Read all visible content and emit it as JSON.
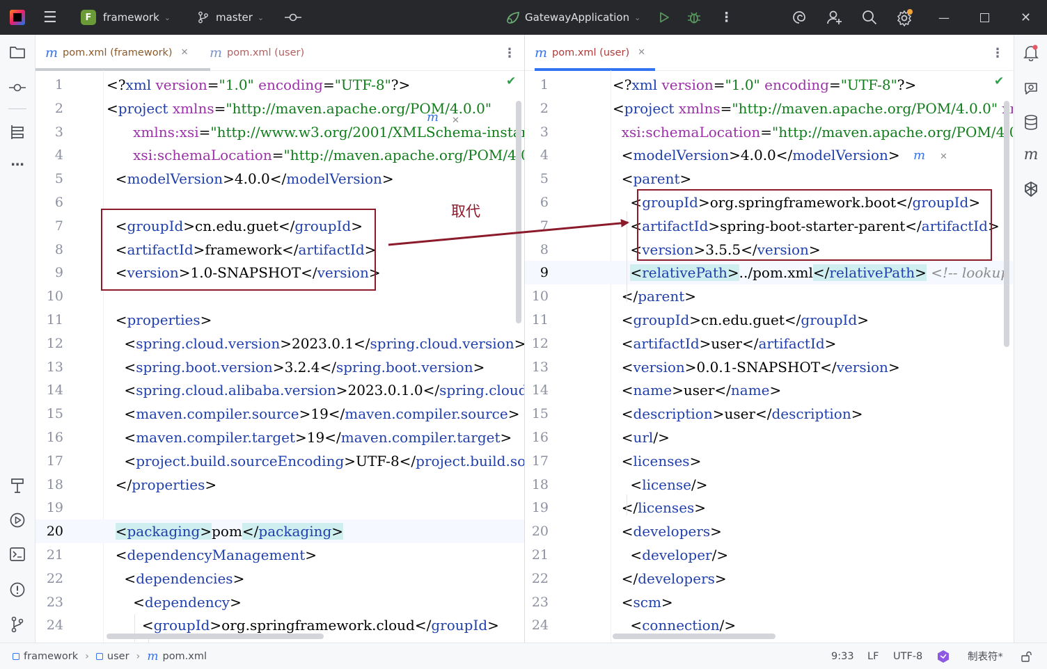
{
  "titlebar": {
    "project_initial": "F",
    "project_name": "framework",
    "branch": "master",
    "run_config": "GatewayApplication"
  },
  "left_pane": {
    "tabs": [
      {
        "label": "pom.xml (framework)",
        "active": true
      },
      {
        "label": "pom.xml (user)",
        "active": false
      }
    ],
    "current_line": 20,
    "lines": [
      [
        [
          "t",
          "<?"
        ],
        [
          "n",
          "xml "
        ],
        [
          "a",
          "version"
        ],
        [
          "t",
          "="
        ],
        [
          "v",
          "\"1.0\""
        ],
        [
          "t",
          " "
        ],
        [
          "a",
          "encoding"
        ],
        [
          "t",
          "="
        ],
        [
          "v",
          "\"UTF-8\""
        ],
        [
          "t",
          "?>"
        ]
      ],
      [
        [
          "t",
          "<"
        ],
        [
          "n",
          "project "
        ],
        [
          "a",
          "xmlns"
        ],
        [
          "t",
          "="
        ],
        [
          "v",
          "\"http://maven.apache.org/POM/4.0.0\""
        ]
      ],
      [
        [
          "t",
          "      "
        ],
        [
          "a",
          "xmlns:xsi"
        ],
        [
          "t",
          "="
        ],
        [
          "v",
          "\"http://www.w3.org/2001/XMLSchema-instance\""
        ]
      ],
      [
        [
          "t",
          "      "
        ],
        [
          "a",
          "xsi:schemaLocation"
        ],
        [
          "t",
          "="
        ],
        [
          "v",
          "\"http://maven.apache.org/POM/4.0.0 http://maven.apache.org/xsd/maven-4.0.0.xsd\""
        ],
        [
          "t",
          ">"
        ]
      ],
      [
        [
          "t",
          "  <"
        ],
        [
          "n",
          "modelVersion"
        ],
        [
          "t",
          ">4.0.0</"
        ],
        [
          "n",
          "modelVersion"
        ],
        [
          "t",
          ">"
        ]
      ],
      [],
      [
        [
          "t",
          "  <"
        ],
        [
          "n",
          "groupId"
        ],
        [
          "t",
          ">cn.edu.guet</"
        ],
        [
          "n",
          "groupId"
        ],
        [
          "t",
          ">"
        ]
      ],
      [
        [
          "t",
          "  <"
        ],
        [
          "n",
          "artifactId"
        ],
        [
          "t",
          ">framework</"
        ],
        [
          "n",
          "artifactId"
        ],
        [
          "t",
          ">"
        ]
      ],
      [
        [
          "t",
          "  <"
        ],
        [
          "n",
          "version"
        ],
        [
          "t",
          ">1.0-SNAPSHOT</"
        ],
        [
          "n",
          "version"
        ],
        [
          "t",
          ">"
        ]
      ],
      [],
      [
        [
          "t",
          "  <"
        ],
        [
          "n",
          "properties"
        ],
        [
          "t",
          ">"
        ]
      ],
      [
        [
          "t",
          "    <"
        ],
        [
          "n",
          "spring.cloud.version"
        ],
        [
          "t",
          ">2023.0.1</"
        ],
        [
          "n",
          "spring.cloud.version"
        ],
        [
          "t",
          ">"
        ]
      ],
      [
        [
          "t",
          "    <"
        ],
        [
          "n",
          "spring.boot.version"
        ],
        [
          "t",
          ">3.2.4</"
        ],
        [
          "n",
          "spring.boot.version"
        ],
        [
          "t",
          ">"
        ]
      ],
      [
        [
          "t",
          "    <"
        ],
        [
          "n",
          "spring.cloud.alibaba.version"
        ],
        [
          "t",
          ">2023.0.1.0</"
        ],
        [
          "n",
          "spring.cloud.alibaba.version"
        ],
        [
          "t",
          ">"
        ]
      ],
      [
        [
          "t",
          "    <"
        ],
        [
          "n",
          "maven.compiler.source"
        ],
        [
          "t",
          ">19</"
        ],
        [
          "n",
          "maven.compiler.source"
        ],
        [
          "t",
          ">"
        ]
      ],
      [
        [
          "t",
          "    <"
        ],
        [
          "n",
          "maven.compiler.target"
        ],
        [
          "t",
          ">19</"
        ],
        [
          "n",
          "maven.compiler.target"
        ],
        [
          "t",
          ">"
        ]
      ],
      [
        [
          "t",
          "    <"
        ],
        [
          "n",
          "project.build.sourceEncoding"
        ],
        [
          "t",
          ">UTF-8</"
        ],
        [
          "n",
          "project.build.sourceEncoding"
        ],
        [
          "t",
          ">"
        ]
      ],
      [
        [
          "t",
          "  </"
        ],
        [
          "n",
          "properties"
        ],
        [
          "t",
          ">"
        ]
      ],
      [],
      [
        [
          "t",
          "  "
        ],
        [
          "h",
          "<packaging>"
        ],
        [
          "t",
          "pom"
        ],
        [
          "h",
          "</packaging>"
        ]
      ],
      [
        [
          "t",
          "  <"
        ],
        [
          "n",
          "dependencyManagement"
        ],
        [
          "t",
          ">"
        ]
      ],
      [
        [
          "t",
          "    <"
        ],
        [
          "n",
          "dependencies"
        ],
        [
          "t",
          ">"
        ]
      ],
      [
        [
          "t",
          "      <"
        ],
        [
          "n",
          "dependency"
        ],
        [
          "t",
          ">"
        ]
      ],
      [
        [
          "t",
          "        <"
        ],
        [
          "n",
          "groupId"
        ],
        [
          "t",
          ">org.springframework.cloud</"
        ],
        [
          "n",
          "groupId"
        ],
        [
          "t",
          ">"
        ]
      ]
    ]
  },
  "right_pane": {
    "tabs": [
      {
        "label": "pom.xml (user)",
        "active": true
      }
    ],
    "current_line": 9,
    "lines": [
      [
        [
          "t",
          "<?"
        ],
        [
          "n",
          "xml "
        ],
        [
          "a",
          "version"
        ],
        [
          "t",
          "="
        ],
        [
          "v",
          "\"1.0\""
        ],
        [
          "t",
          " "
        ],
        [
          "a",
          "encoding"
        ],
        [
          "t",
          "="
        ],
        [
          "v",
          "\"UTF-8\""
        ],
        [
          "t",
          "?>"
        ]
      ],
      [
        [
          "t",
          "<"
        ],
        [
          "n",
          "project "
        ],
        [
          "a",
          "xmlns"
        ],
        [
          "t",
          "="
        ],
        [
          "v",
          "\"http://maven.apache.org/POM/4.0.0\""
        ],
        [
          "t",
          " "
        ],
        [
          "a",
          "xmlns:xsi"
        ],
        [
          "t",
          "="
        ],
        [
          "v",
          "\"http://www.w3.org/2001/XMLSchema-instance\""
        ]
      ],
      [
        [
          "t",
          "  "
        ],
        [
          "a",
          "xsi:schemaLocation"
        ],
        [
          "t",
          "="
        ],
        [
          "v",
          "\"http://maven.apache.org/POM/4.0.0 https://maven.apache.org/xsd/maven-4.0.0.xsd\""
        ],
        [
          "t",
          ">"
        ]
      ],
      [
        [
          "t",
          "  <"
        ],
        [
          "n",
          "modelVersion"
        ],
        [
          "t",
          ">4.0.0</"
        ],
        [
          "n",
          "modelVersion"
        ],
        [
          "t",
          ">"
        ]
      ],
      [
        [
          "t",
          "  <"
        ],
        [
          "n",
          "parent"
        ],
        [
          "t",
          ">"
        ]
      ],
      [
        [
          "t",
          "    <"
        ],
        [
          "n",
          "groupId"
        ],
        [
          "t",
          ">org.springframework.boot</"
        ],
        [
          "n",
          "groupId"
        ],
        [
          "t",
          ">"
        ]
      ],
      [
        [
          "t",
          "    <"
        ],
        [
          "n",
          "artifactId"
        ],
        [
          "t",
          ">spring-boot-starter-parent</"
        ],
        [
          "n",
          "artifactId"
        ],
        [
          "t",
          ">"
        ]
      ],
      [
        [
          "t",
          "    <"
        ],
        [
          "n",
          "version"
        ],
        [
          "t",
          ">3.5.5</"
        ],
        [
          "n",
          "version"
        ],
        [
          "t",
          ">"
        ]
      ],
      [
        [
          "t",
          "    "
        ],
        [
          "h",
          "<relativePath>"
        ],
        [
          "t",
          "../pom.xml"
        ],
        [
          "h",
          "</relativePath>"
        ],
        [
          "t",
          " "
        ],
        [
          "c",
          "<!-- lookup parent from repository -->"
        ]
      ],
      [
        [
          "t",
          "  </"
        ],
        [
          "n",
          "parent"
        ],
        [
          "t",
          ">"
        ]
      ],
      [
        [
          "t",
          "  <"
        ],
        [
          "n",
          "groupId"
        ],
        [
          "t",
          ">cn.edu.guet</"
        ],
        [
          "n",
          "groupId"
        ],
        [
          "t",
          ">"
        ]
      ],
      [
        [
          "t",
          "  <"
        ],
        [
          "n",
          "artifactId"
        ],
        [
          "t",
          ">user</"
        ],
        [
          "n",
          "artifactId"
        ],
        [
          "t",
          ">"
        ]
      ],
      [
        [
          "t",
          "  <"
        ],
        [
          "n",
          "version"
        ],
        [
          "t",
          ">0.0.1-SNAPSHOT</"
        ],
        [
          "n",
          "version"
        ],
        [
          "t",
          ">"
        ]
      ],
      [
        [
          "t",
          "  <"
        ],
        [
          "n",
          "name"
        ],
        [
          "t",
          ">user</"
        ],
        [
          "n",
          "name"
        ],
        [
          "t",
          ">"
        ]
      ],
      [
        [
          "t",
          "  <"
        ],
        [
          "n",
          "description"
        ],
        [
          "t",
          ">user</"
        ],
        [
          "n",
          "description"
        ],
        [
          "t",
          ">"
        ]
      ],
      [
        [
          "t",
          "  <"
        ],
        [
          "n",
          "url"
        ],
        [
          "t",
          "/>"
        ]
      ],
      [
        [
          "t",
          "  <"
        ],
        [
          "n",
          "licenses"
        ],
        [
          "t",
          ">"
        ]
      ],
      [
        [
          "t",
          "    <"
        ],
        [
          "n",
          "license"
        ],
        [
          "t",
          "/>"
        ]
      ],
      [
        [
          "t",
          "  </"
        ],
        [
          "n",
          "licenses"
        ],
        [
          "t",
          ">"
        ]
      ],
      [
        [
          "t",
          "  <"
        ],
        [
          "n",
          "developers"
        ],
        [
          "t",
          ">"
        ]
      ],
      [
        [
          "t",
          "    <"
        ],
        [
          "n",
          "developer"
        ],
        [
          "t",
          "/>"
        ]
      ],
      [
        [
          "t",
          "  </"
        ],
        [
          "n",
          "developers"
        ],
        [
          "t",
          ">"
        ]
      ],
      [
        [
          "t",
          "  <"
        ],
        [
          "n",
          "scm"
        ],
        [
          "t",
          ">"
        ]
      ],
      [
        [
          "t",
          "    <"
        ],
        [
          "n",
          "connection"
        ],
        [
          "t",
          "/>"
        ]
      ]
    ]
  },
  "annotation": {
    "label": "取代"
  },
  "statusbar": {
    "breadcrumb": [
      "framework",
      "user",
      "pom.xml"
    ],
    "position": "9:33",
    "line_separator": "LF",
    "encoding": "UTF-8",
    "indent": "制表符*"
  },
  "icons": {
    "left_sidebar": [
      "folder-icon",
      "commit-icon",
      "structure-icon",
      "more-icon",
      "build-icon",
      "run-icon",
      "terminal-icon",
      "problems-icon",
      "git-icon"
    ],
    "right_sidebar": [
      "notifications-icon",
      "ai-assistant-icon",
      "database-icon",
      "maven-icon",
      "openai-icon"
    ]
  },
  "colors": {
    "tag": "#1f3fab",
    "attribute": "#9b30a8",
    "string": "#107c1a",
    "comment": "#8c8c8c",
    "annotation": "#8b1a2b",
    "accent": "#3574f0"
  }
}
